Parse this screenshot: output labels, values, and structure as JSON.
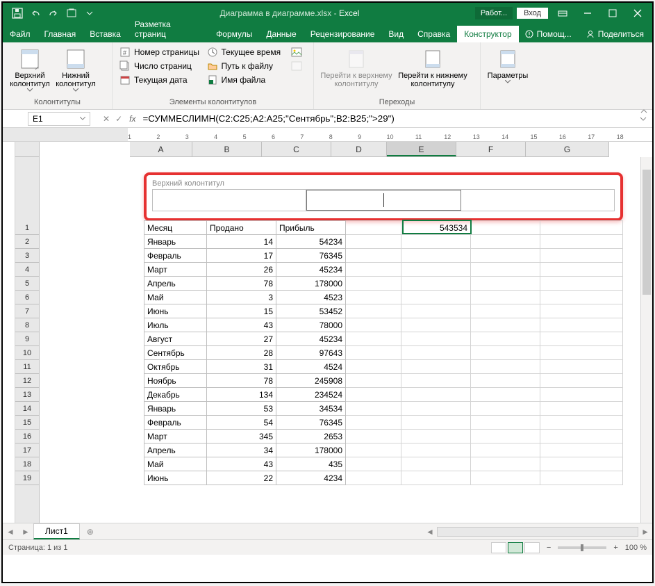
{
  "title": {
    "doc": "Диаграмма в диаграмме.xlsx",
    "sep": " - ",
    "app": "Excel"
  },
  "qat": {
    "save": "save-icon",
    "undo": "undo-icon",
    "redo": "redo-icon",
    "open": "open-icon"
  },
  "titlebarRight": {
    "mode": "Работ...",
    "login": "Вход"
  },
  "tabs": [
    "Файл",
    "Главная",
    "Вставка",
    "Разметка страниц",
    "Формулы",
    "Данные",
    "Рецензирование",
    "Вид",
    "Справка",
    "Конструктор"
  ],
  "tell": "Помощ...",
  "share": "Поделиться",
  "ribbon": {
    "group1": {
      "label": "Колонтитулы",
      "btn1": "Верхний колонтитул",
      "btn2": "Нижний колонтитул"
    },
    "group2": {
      "label": "Элементы колонтитулов",
      "items": [
        "Номер страницы",
        "Число страниц",
        "Текущая дата",
        "Текущее время",
        "Путь к файлу",
        "Имя файла"
      ]
    },
    "group3": {
      "label": "Переходы",
      "btn1": "Перейти к верхнему колонтитулу",
      "btn2": "Перейти к нижнему колонтитулу"
    },
    "group4": {
      "label": "",
      "btn": "Параметры"
    }
  },
  "namebox": "E1",
  "formula": "=СУММЕСЛИМН(C2:C25;A2:A25;\"Сентябрь\";B2:B25;\">29\")",
  "rulerH": [
    "1",
    "2",
    "3",
    "4",
    "5",
    "6",
    "7",
    "8",
    "9",
    "10",
    "11",
    "12",
    "13",
    "14",
    "15",
    "16",
    "17",
    "18"
  ],
  "cols": [
    "A",
    "B",
    "C",
    "D",
    "E",
    "F",
    "G"
  ],
  "headerZoneLabel": "Верхний колонтитул",
  "tableHeaders": [
    "Месяц",
    "Продано",
    "Прибыль"
  ],
  "e1value": "543534",
  "rows": [
    [
      "Январь",
      "14",
      "54234"
    ],
    [
      "Февраль",
      "17",
      "76345"
    ],
    [
      "Март",
      "26",
      "45234"
    ],
    [
      "Апрель",
      "78",
      "178000"
    ],
    [
      "Май",
      "3",
      "4523"
    ],
    [
      "Июнь",
      "15",
      "53452"
    ],
    [
      "Июль",
      "43",
      "78000"
    ],
    [
      "Август",
      "27",
      "45234"
    ],
    [
      "Сентябрь",
      "28",
      "97643"
    ],
    [
      "Октябрь",
      "31",
      "4524"
    ],
    [
      "Ноябрь",
      "78",
      "245908"
    ],
    [
      "Декабрь",
      "134",
      "234524"
    ],
    [
      "Январь",
      "53",
      "34534"
    ],
    [
      "Февраль",
      "54",
      "76345"
    ],
    [
      "Март",
      "345",
      "2653"
    ],
    [
      "Апрель",
      "34",
      "178000"
    ],
    [
      "Май",
      "43",
      "435"
    ],
    [
      "Июнь",
      "22",
      "4234"
    ]
  ],
  "sheetTab": "Лист1",
  "status": "Страница: 1 из 1",
  "zoom": "100 %"
}
